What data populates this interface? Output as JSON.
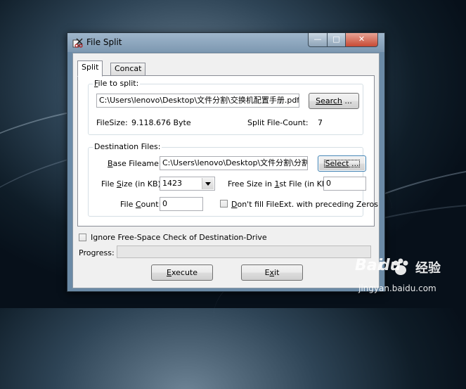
{
  "window": {
    "title": "File Split",
    "controls": {
      "minimize": "—",
      "maximize": "□",
      "close": "✕"
    }
  },
  "tabs": [
    {
      "label": "Split",
      "selected": true
    },
    {
      "label": "Concat",
      "selected": false
    }
  ],
  "file_group": {
    "legend_key": "F",
    "legend_rest": "ile to split:",
    "path_value": "C:\\Users\\lenovo\\Desktop\\文件分割\\交换机配置手册.pdf",
    "search_key": "Search",
    "search_rest": " ...",
    "filesize_label": "FileSize:",
    "filesize_value": "9.118.676 Byte",
    "count_label": "Split File-Count:",
    "count_value": "7"
  },
  "dest_group": {
    "legend": "Destination Files:",
    "base_label_key": "B",
    "base_label_rest": "ase Fileame:",
    "base_value": "C:\\Users\\lenovo\\Desktop\\文件分割\\分割",
    "select_key": "Select",
    "select_rest": " ...",
    "size_label_a": "File ",
    "size_label_key": "S",
    "size_label_b": "ize (in KB):",
    "size_value": "1423",
    "free_label_a": "Free Size in ",
    "free_label_key": "1",
    "free_label_b": "st File (in KB):",
    "free_value": "0",
    "count_label_a": "File ",
    "count_label_key": "C",
    "count_label_b": "ount:",
    "count_value": "0",
    "fill_ext_key": "D",
    "fill_ext_rest": "on't fill FileExt. with preceding Zeros",
    "fill_ext_checked": false
  },
  "ignore_check": {
    "label": "Ignore Free-Space Check of Destination-Drive",
    "checked": false
  },
  "progress": {
    "label": "Progress:",
    "value": 0
  },
  "buttons": {
    "execute_key": "E",
    "execute_rest": "xecute",
    "exit_key": "x",
    "exit_a": "E",
    "exit_b": "it"
  },
  "watermark": {
    "brand_a": "Bai",
    "brand_b": "du",
    "brand_c": "经验",
    "url": "jingyan.baidu.com"
  },
  "colors": {
    "progress_fill": "#37b34a",
    "close_button": "#c74a34",
    "focus_border": "#3c7fb1"
  }
}
